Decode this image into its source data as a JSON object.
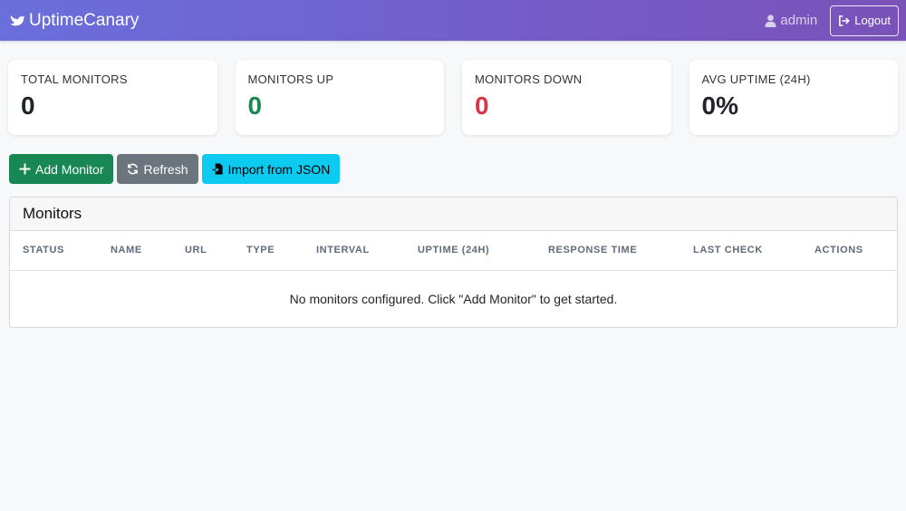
{
  "navbar": {
    "brand": "UptimeCanary",
    "user": "admin",
    "logout_label": "Logout"
  },
  "stats": [
    {
      "label": "TOTAL MONITORS",
      "value": "0"
    },
    {
      "label": "MONITORS UP",
      "value": "0"
    },
    {
      "label": "MONITORS DOWN",
      "value": "0"
    },
    {
      "label": "AVG UPTIME (24H)",
      "value": "0%"
    }
  ],
  "toolbar": {
    "add_label": "Add Monitor",
    "refresh_label": "Refresh",
    "import_label": "Import from JSON"
  },
  "monitors": {
    "title": "Monitors",
    "columns": [
      "STATUS",
      "NAME",
      "URL",
      "TYPE",
      "INTERVAL",
      "UPTIME (24H)",
      "RESPONSE TIME",
      "LAST CHECK",
      "ACTIONS"
    ],
    "empty_message": "No monitors configured. Click \"Add Monitor\" to get started."
  },
  "colors": {
    "accent": "#6a6fdc",
    "success": "#198754",
    "danger": "#dc3545",
    "info": "#0dcaf0",
    "secondary": "#6c757d"
  },
  "icons": {
    "brand": "bird-icon",
    "user": "user-icon",
    "logout": "sign-out-icon",
    "add": "plus-icon",
    "refresh": "refresh-icon",
    "import": "file-import-icon"
  }
}
